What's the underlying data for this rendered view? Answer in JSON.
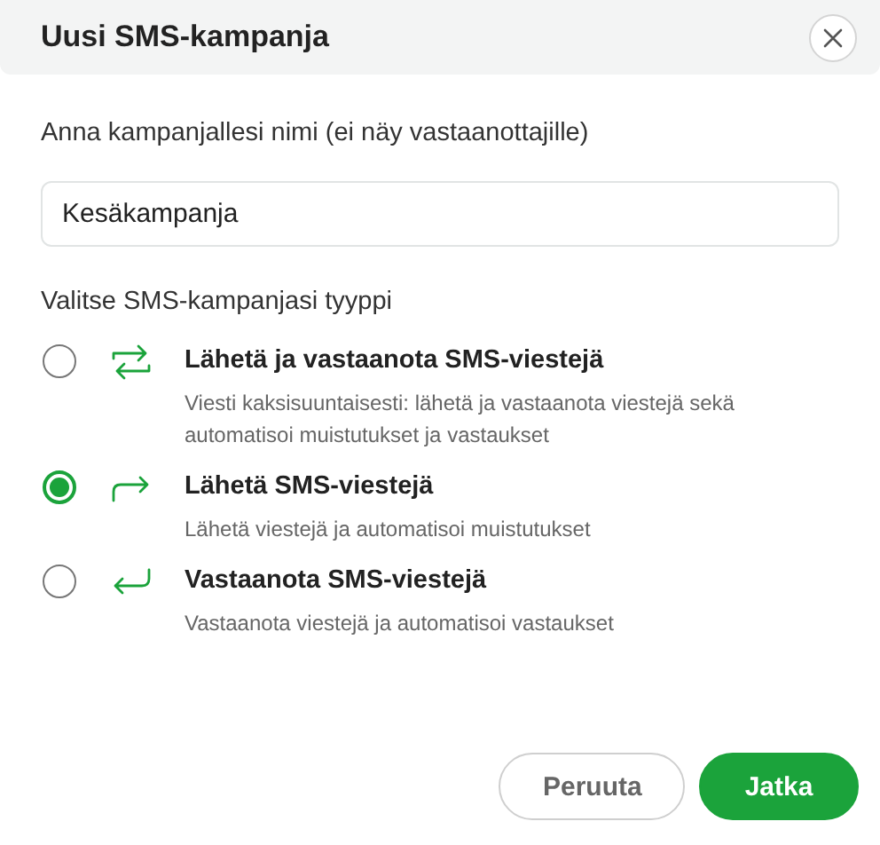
{
  "dialog": {
    "title": "Uusi SMS-kampanja"
  },
  "name_field": {
    "label": "Anna kampanjallesi nimi (ei näy vastaanottajille)",
    "value": "Kesäkampanja"
  },
  "type_group": {
    "label": "Valitse SMS-kampanjasi tyyppi",
    "options": [
      {
        "kind": "two-way",
        "title": "Lähetä ja vastaanota SMS-viestejä",
        "description": "Viesti kaksisuuntaisesti: lähetä ja vastaanota viestejä sekä automatisoi muistutukset ja vastaukset",
        "selected": false
      },
      {
        "kind": "send",
        "title": "Lähetä SMS-viestejä",
        "description": "Lähetä viestejä ja automatisoi muistutukset",
        "selected": true
      },
      {
        "kind": "receive",
        "title": "Vastaanota SMS-viestejä",
        "description": "Vastaanota viestejä ja automatisoi vastaukset",
        "selected": false
      }
    ]
  },
  "buttons": [
    {
      "kind": "secondary",
      "label": "Peruuta"
    },
    {
      "kind": "primary",
      "label": "Jatka"
    }
  ]
}
